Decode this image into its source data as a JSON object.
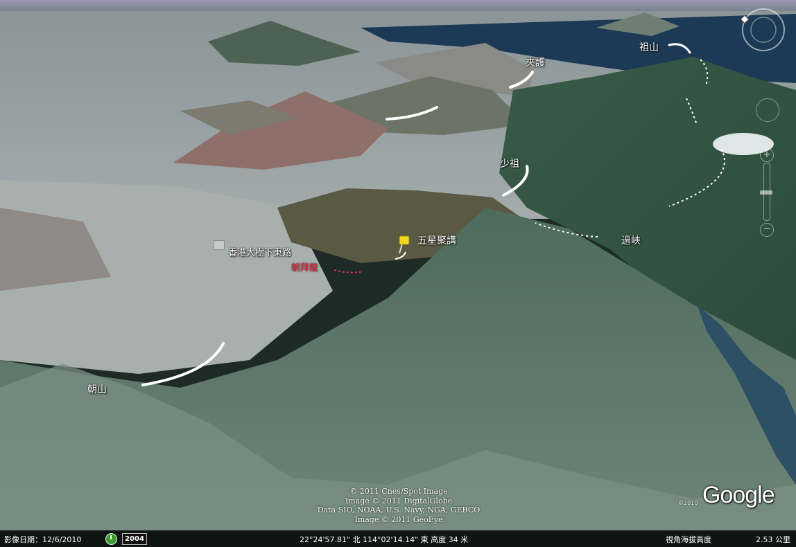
{
  "map": {
    "labels": {
      "zushan": "祖山",
      "jiahu": "夾護",
      "shaozu": "少祖",
      "guoxia": "過峽",
      "wuxing": "五星聚講",
      "road": "香港大樹下東路",
      "chaobai": "朝拜龍",
      "chaoshan": "朝山"
    },
    "colors": {
      "sky": "#8f8aa6",
      "water": "#15304a",
      "mountain": "#3f5f4f",
      "red_label": "#e0323c",
      "pin": "#f2d81c"
    }
  },
  "credits": {
    "line1": "© 2011 Cnes/Spot Image",
    "line2": "Image © 2011 DigitalGlobe",
    "line3": "Data SIO, NOAA, U.S. Navy, NGA, GEBCO",
    "line4": "Image © 2011 GeoEye"
  },
  "brand": {
    "logo": "Google",
    "year": "©2010"
  },
  "statusbar": {
    "imagery_date": "影像日期：12/6/2010",
    "year_badge": "2004",
    "coordinates": "22°24'57.81\" 北 114°02'14.14\" 東 高度   34 米",
    "eye_alt_label": "視角海拔高度",
    "eye_alt_value": "2.53 公里"
  },
  "navigation": {
    "zoom_plus": "+",
    "zoom_minus": "−"
  }
}
